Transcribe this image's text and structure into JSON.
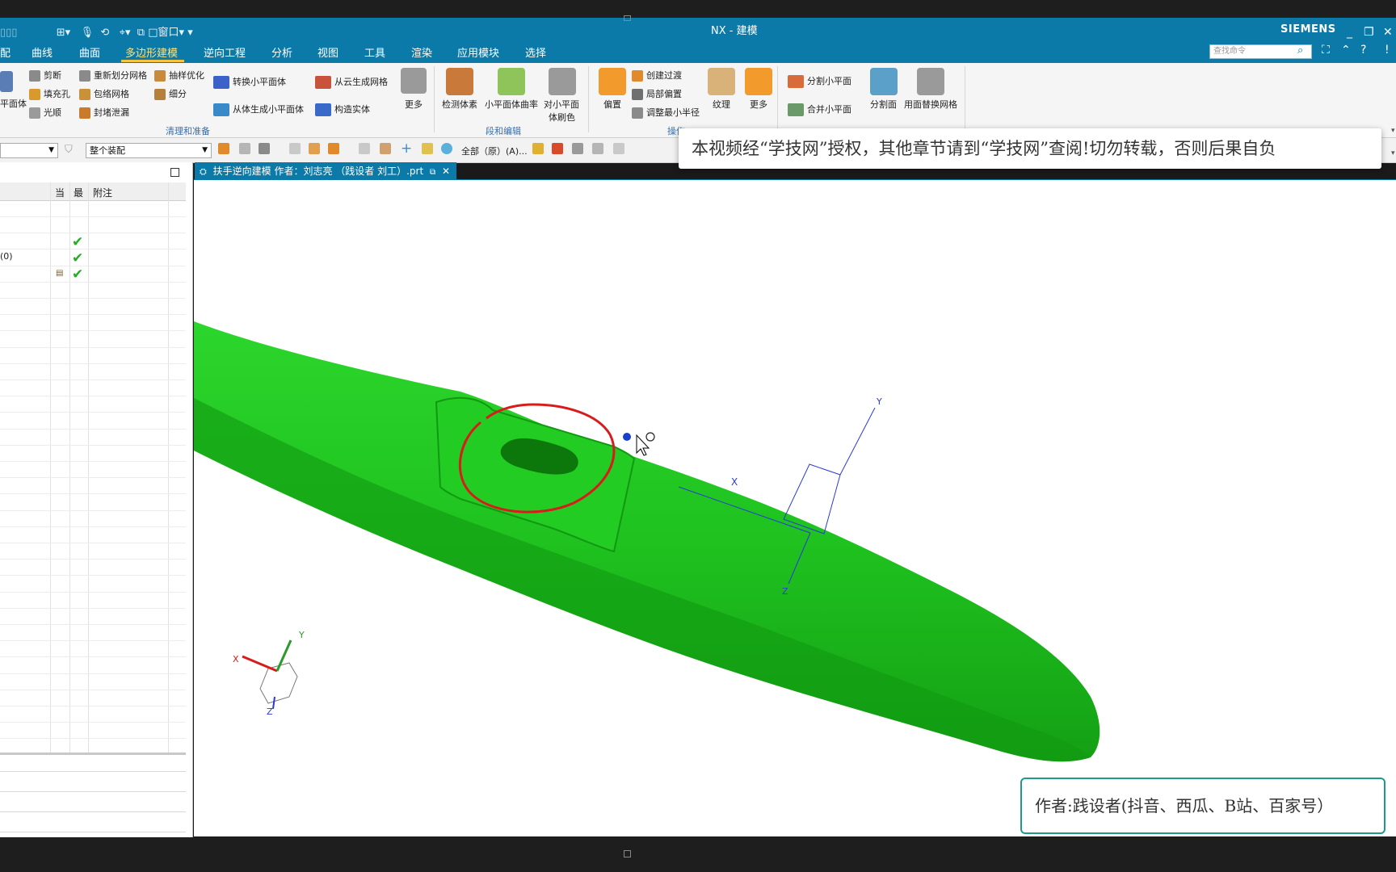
{
  "window": {
    "title": "NX - 建模",
    "brand": "SIEMENS",
    "window_menu": "窗口",
    "controls": [
      "_",
      "❐",
      "✕"
    ]
  },
  "menu": {
    "tabs": [
      "配",
      "曲线",
      "曲面",
      "多边形建模",
      "逆向工程",
      "分析",
      "视图",
      "工具",
      "渲染",
      "应用模块",
      "选择"
    ],
    "active": "多边形建模",
    "search_placeholder": "查找命令"
  },
  "ribbon": {
    "col1": [
      "平面体"
    ],
    "col2": [
      "剪断",
      "填充孔",
      "光顺"
    ],
    "col3": [
      "重新划分网格",
      "包络网格",
      "封堵泄漏"
    ],
    "col4": [
      "抽样优化",
      "细分"
    ],
    "col5": [
      "转换小平面体",
      "从体生成小平面体"
    ],
    "col6": [
      "从云生成网格",
      "构造实体"
    ],
    "more1": "更多",
    "group1_label": "清理和准备",
    "big2": [
      "检测体素",
      "小平面体曲率",
      "对小平面",
      "体刷色"
    ],
    "group2_label": "段和编辑",
    "offset": "偏置",
    "col7": [
      "创建过渡",
      "局部偏置",
      "调整最小半径"
    ],
    "texture": "纹理",
    "more2": "更多",
    "group3_label": "操作",
    "col8": [
      "分割小平面",
      "合并小平面"
    ],
    "split_face": "分割面",
    "replace_mesh": "用面替换网格"
  },
  "toolbar2": {
    "filter_value": "整个装配",
    "scope_text": "全部（原）(A)..."
  },
  "left_panel": {
    "columns": [
      "当",
      "最",
      "附注"
    ],
    "row_label": "(0)"
  },
  "doc_tab": {
    "title": "扶手逆向建模  作者：刘志亮 （践设者 刘工）.prt",
    "close": "✕"
  },
  "overlay": {
    "notice": "本视频经“学技网”授权，其他章节请到“学技网”查阅!切勿转载，否则后果自负",
    "author": "作者:践设者(抖音、西瓜、B站、百家号）"
  },
  "axes": {
    "x": "X",
    "y": "Y",
    "z": "Z"
  },
  "colors": {
    "titlebar": "#0b7aa8",
    "model": "#1fc21f",
    "annotation": "#d81c1c",
    "accent": "#f5c342"
  }
}
